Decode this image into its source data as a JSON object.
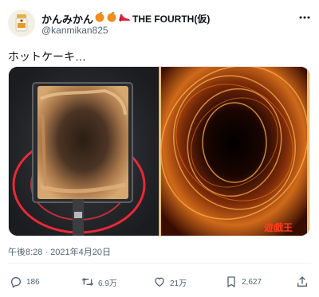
{
  "author": {
    "display_name": "かんみかん",
    "suffix": "THE FOURTH(仮)",
    "handle": "@kanmikan825"
  },
  "tweet": {
    "text": "ホットケーキ…",
    "timestamp": "午後8:28 · 2021年4月20日",
    "right_image_caption": "遊戯王"
  },
  "actions": {
    "replies": "186",
    "retweets": "6.9万",
    "likes": "21万",
    "bookmarks": "2,627"
  },
  "icons": {
    "more": "more-dots-icon",
    "reply": "reply-icon",
    "retweet": "retweet-icon",
    "like": "heart-icon",
    "bookmark": "bookmark-icon",
    "share": "share-icon"
  },
  "colors": {
    "text": "#0f1419",
    "secondary": "#536471"
  }
}
